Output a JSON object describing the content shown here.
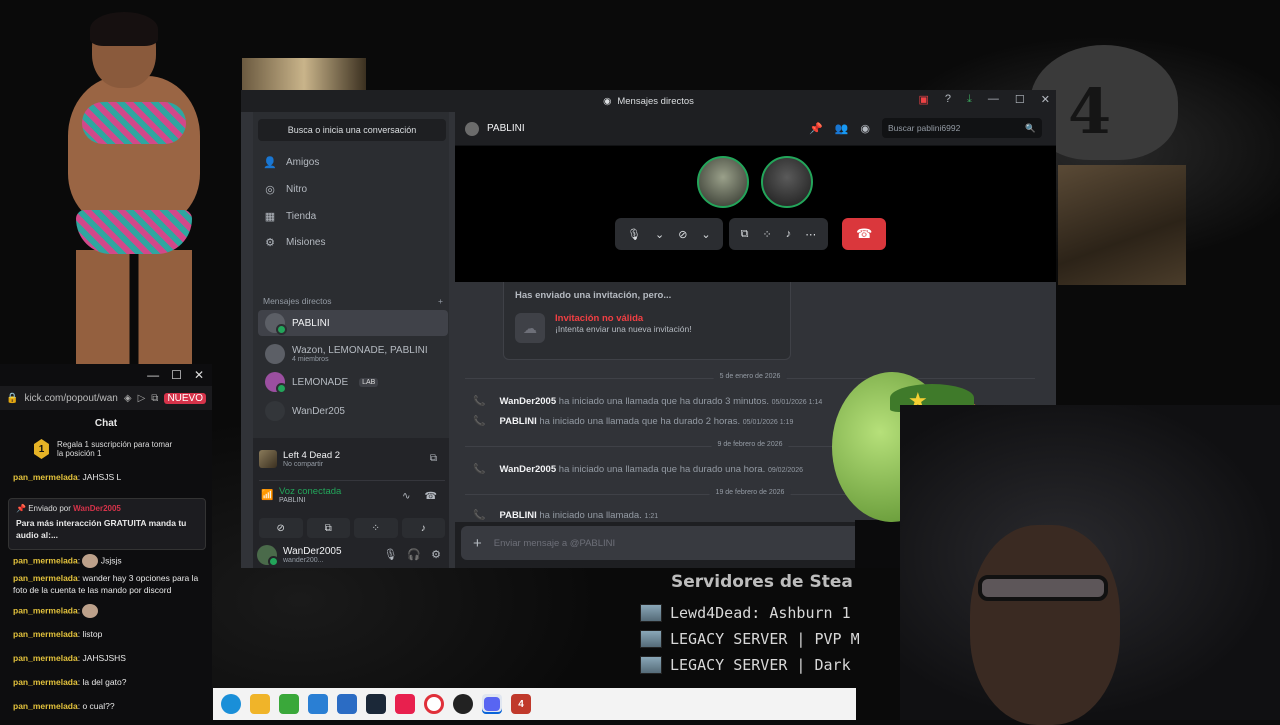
{
  "discord": {
    "window_title": "Mensajes directos",
    "search_button": "Busca o inicia una conversación",
    "nav": [
      "Amigos",
      "Nitro",
      "Tienda",
      "Misiones"
    ],
    "dm_header": "Mensajes directos",
    "dms": [
      {
        "name": "PABLINI",
        "sub": ""
      },
      {
        "name": "Wazon, LEMONADE, PABLINI",
        "sub": "4 miembros"
      },
      {
        "name": "LEMONADE",
        "tag": "LAB"
      },
      {
        "name": "WanDer205",
        "sub": ""
      }
    ],
    "activity": {
      "title": "Left 4 Dead 2",
      "subtitle": "No compartir"
    },
    "voice": {
      "status": "Voz conectada",
      "channel": "PABLINI"
    },
    "user": {
      "name": "WanDer2005",
      "tag": "wander200..."
    },
    "channel": {
      "name": "PABLINI",
      "search_placeholder": "Buscar pablini6992"
    },
    "invite": {
      "title": "Has enviado una invitación, pero...",
      "error": "Invitación no válida",
      "hint": "¡Intenta enviar una nueva invitación!"
    },
    "dividers": [
      "5 de enero de 2026",
      "9 de febrero de 2026",
      "19 de febrero de 2026"
    ],
    "calls": [
      {
        "user": "WanDer2005",
        "text": "ha iniciado una llamada que ha durado 3 minutos.",
        "ts": "05/01/2026 1:14"
      },
      {
        "user": "PABLINI",
        "text": "ha iniciado una llamada que ha durado 2 horas.",
        "ts": "05/01/2026 1:19"
      },
      {
        "user": "WanDer2005",
        "text": "ha iniciado una llamada que ha durado una hora.",
        "ts": "09/02/2026"
      },
      {
        "user": "PABLINI",
        "text": "ha iniciado una llamada.",
        "ts": "1:21"
      }
    ],
    "composer_placeholder": "Enviar mensaje a @PABLINI"
  },
  "chat": {
    "url": "kick.com/popout/wande",
    "nuevo": "NUEVO",
    "title": "Chat",
    "sub_text": "Regala 1 suscripción para tomar la posición 1",
    "sub_badge": "1",
    "pinned_by_label": "Enviado por",
    "pinned_by_user": "WanDer2005",
    "pinned_text": "Para más interacción GRATUITA manda tu audio al:...",
    "messages": [
      {
        "user": "pan_mermelada",
        "text": "JAHSJS L"
      },
      {
        "user": "pan_mermelada",
        "text": "Jsjsjs"
      },
      {
        "user": "pan_mermelada",
        "text": "wander hay 3 opciones para la foto de la cuenta te las mando por discord"
      },
      {
        "user": "pan_mermelada",
        "text": ""
      },
      {
        "user": "pan_mermelada",
        "text": "listop"
      },
      {
        "user": "pan_mermelada",
        "text": "JAHSJSHS"
      },
      {
        "user": "pan_mermelada",
        "text": "la del gato?"
      },
      {
        "user": "pan_mermelada",
        "text": "o cual??"
      }
    ]
  },
  "servers": {
    "title": "Servidores de Stea",
    "rows": [
      "Lewd4Dead: Ashburn 1",
      "LEGACY SERVER | PVP M",
      "LEGACY SERVER | Dark"
    ]
  },
  "colors": {
    "discord_bg": "#313338",
    "green": "#23a55a",
    "red": "#da373c",
    "kick_accent": "#d5334a"
  }
}
